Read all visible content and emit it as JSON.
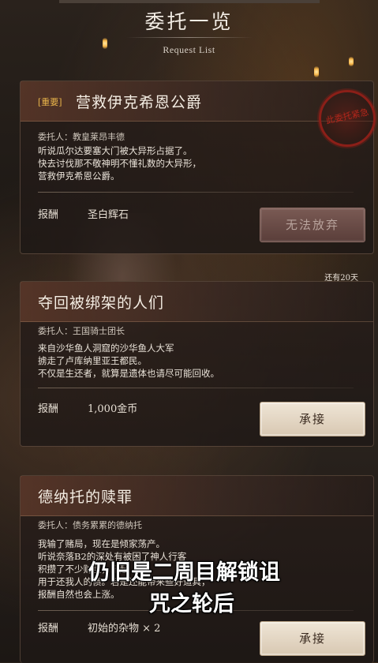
{
  "header": {
    "title": "委托一览",
    "subtitle": "Request List"
  },
  "labels": {
    "client": "委托人：",
    "reward": "报酬"
  },
  "seal": {
    "text": "此委托紧急"
  },
  "quests": [
    {
      "badge": "[重要]",
      "title": "营救伊克希恩公爵",
      "client": "教皇莱昂丰德",
      "description": "听说瓜尔达要塞大门被大异形占据了。\n快去讨伐那不敬神明不懂礼数的大异形，\n营救伊克希恩公爵。",
      "reward": "圣白辉石",
      "button": "无法放弃",
      "button_state": "disabled"
    },
    {
      "days_left": "还有20天",
      "title": "夺回被绑架的人们",
      "client": "王国骑士团长",
      "description": "来自沙华鱼人洞窟的沙华鱼人大军\n掳走了卢库纳里亚王都民。\n不仅是生还者，就算是遗体也请尽可能回收。",
      "reward": "1,000金币",
      "button": "承接",
      "button_state": "enabled"
    },
    {
      "title": "德纳托的赎罪",
      "client": "债务累累的德纳托",
      "description": "我输了赌局，现在是倾家荡产。\n听说奈落B2的深处有被困了神人",
      "description_lines": [
        "我输了赌局，现在是倾家荡产。",
        "听说奈落B2的深处有被困了神人行客",
        "积攒了不少财宝，邪起",
        "用于还我人的债。若是还能带来些好道具，",
        "报酬自然也会上涨。"
      ],
      "reward": "初始的杂物 × 2",
      "button": "承接",
      "button_state": "enabled"
    }
  ],
  "overlay_subtitle": {
    "line1": "仍旧是二周目解锁诅",
    "line2": "咒之轮后"
  }
}
